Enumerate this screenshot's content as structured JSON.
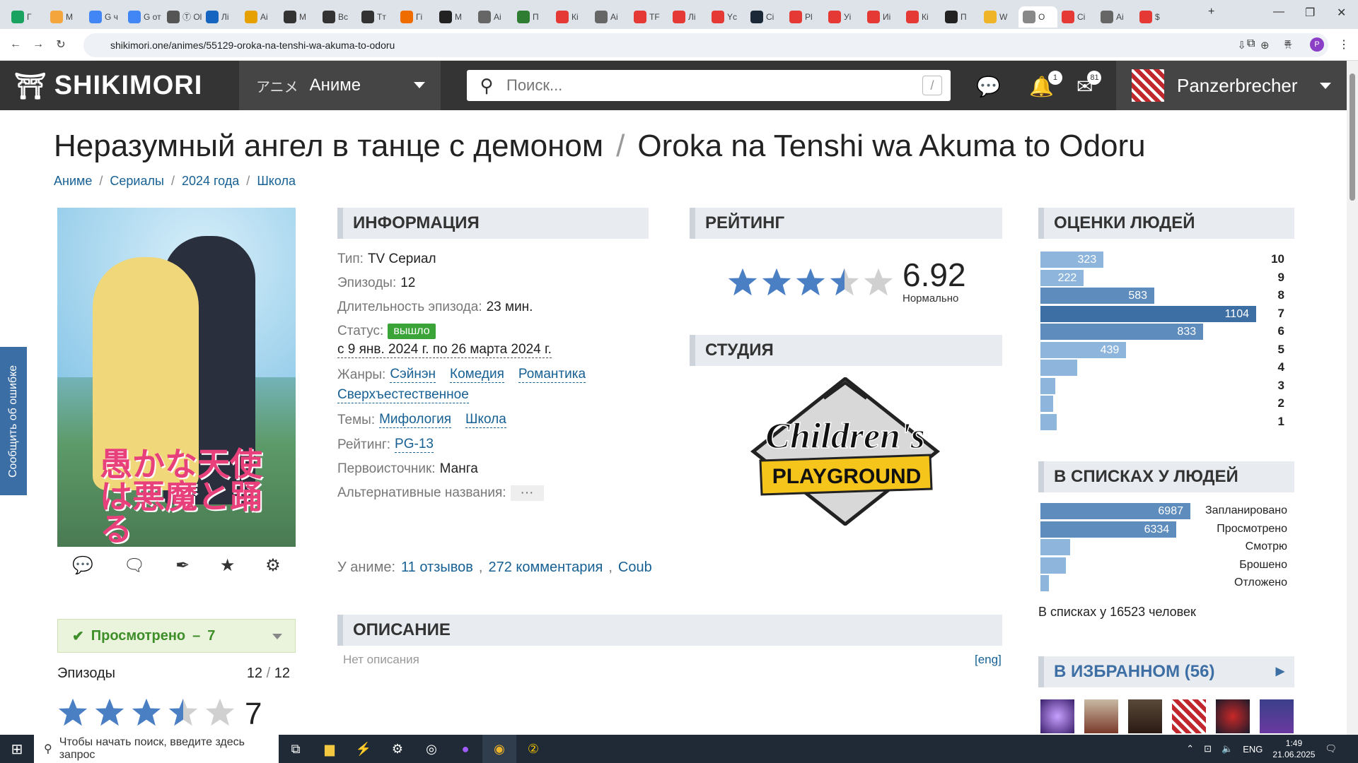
{
  "browser": {
    "tabs": [
      "Г",
      "М",
      "G ч",
      "G от",
      "Ⓣ Ol",
      "Лі",
      "Ai",
      "М",
      "Вс",
      "Тт",
      "Гі",
      "М",
      "Аі",
      "П",
      "Кі",
      "Аі",
      "ТF",
      "Лі",
      "Yc",
      "Сі",
      "Рl",
      "Уі",
      "Иі",
      "Кі",
      "П",
      "W",
      "О",
      "Сі",
      "Аі",
      "$"
    ],
    "url": "shikimori.one/animes/55129-oroka-na-tenshi-wa-akuma-to-odoru",
    "profile_initial": "P"
  },
  "header": {
    "logo": "SHIKIMORI",
    "section_kana": "アニメ",
    "section": "Аниме",
    "search_placeholder": "Поиск...",
    "search_hotkey": "/",
    "notifications_count": "1",
    "messages_count": "81",
    "username": "Panzerbrecher"
  },
  "report_tab": "Сообщить об ошибке",
  "title": {
    "ru": "Неразумный ангел в танце с демоном",
    "separator": "/",
    "jp": "Oroka na Tenshi wa Akuma to Odoru"
  },
  "breadcrumbs": [
    "Аниме",
    "/",
    "Сериалы",
    "/",
    "2024 года",
    "/",
    "Школа"
  ],
  "poster": {
    "title_jp": "愚かな天使は悪魔と踊る"
  },
  "user_rate": {
    "status": "Просмотрено",
    "dash": "–",
    "score": "7",
    "episodes_label": "Эпизоды",
    "episodes_watched": "12",
    "slash": "/",
    "episodes_total": "12",
    "my_score": "7",
    "my_stars": 3.5
  },
  "info": {
    "heading": "ИНФОРМАЦИЯ",
    "type_label": "Тип:",
    "type": "TV Сериал",
    "episodes_label": "Эпизоды:",
    "episodes": "12",
    "duration_label": "Длительность эпизода:",
    "duration": "23 мин.",
    "status_label": "Статус:",
    "status": "вышло",
    "dates": "с 9 янв. 2024 г. по 26 марта 2024 г.",
    "genres_label": "Жанры:",
    "genres": [
      "Сэйнэн",
      "Комедия",
      "Романтика",
      "Сверхъестественное"
    ],
    "themes_label": "Темы:",
    "themes": [
      "Мифология",
      "Школа"
    ],
    "rating_label": "Рейтинг:",
    "rating": "PG-13",
    "source_label": "Первоисточник:",
    "source": "Манга",
    "alt_label": "Альтернативные названия:",
    "alt": "···"
  },
  "about": {
    "label": "У аниме:",
    "reviews": "11 отзывов",
    "comma1": ",",
    "comments": "272 комментария",
    "comma2": ",",
    "coub": "Coub"
  },
  "rating": {
    "heading": "РЕЙТИНГ",
    "score": "6.92",
    "label": "Нормально",
    "stars": 3.5
  },
  "studio": {
    "heading": "СТУДИЯ",
    "name_line1": "Children's",
    "name_line2": "PLAYGROUND"
  },
  "description": {
    "heading": "ОПИСАНИЕ",
    "empty": "Нет описания",
    "lang": "[eng]"
  },
  "scores": {
    "heading": "ОЦЕНКИ ЛЮДЕЙ",
    "rows": [
      {
        "score": "10",
        "count": 323
      },
      {
        "score": "9",
        "count": 222
      },
      {
        "score": "8",
        "count": 583
      },
      {
        "score": "7",
        "count": 1104
      },
      {
        "score": "6",
        "count": 833
      },
      {
        "score": "5",
        "count": 439
      },
      {
        "score": "4",
        "count": 190
      },
      {
        "score": "3",
        "count": 75
      },
      {
        "score": "2",
        "count": 50
      },
      {
        "score": "1",
        "count": 85
      }
    ]
  },
  "lists": {
    "heading": "В СПИСКАХ У ЛЮДЕЙ",
    "rows": [
      {
        "label": "Запланировано",
        "count": 6987
      },
      {
        "label": "Просмотрено",
        "count": 6334
      },
      {
        "label": "Смотрю",
        "count": 1400
      },
      {
        "label": "Брошено",
        "count": 1200
      },
      {
        "label": "Отложено",
        "count": 400
      }
    ],
    "total": "В списках у 16523 человек"
  },
  "favorites": {
    "heading": "В ИЗБРАННОМ",
    "count": "(56)",
    "arrow": "▶"
  },
  "taskbar": {
    "search_placeholder": "Чтобы начать поиск, введите здесь запрос",
    "lang": "ENG",
    "time": "1:49",
    "date": "21.06.2025"
  },
  "colors": {
    "accent": "#176093",
    "bar_light": "#8eb5dc",
    "bar_dark": "#3d6fa5",
    "status_green": "#3ba439",
    "header_bg": "#343434",
    "star": "#4a7fc4"
  }
}
